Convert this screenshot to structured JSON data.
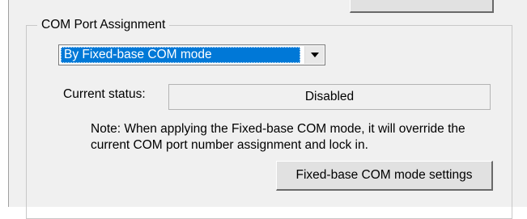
{
  "group": {
    "title": "COM Port Assignment"
  },
  "mode_select": {
    "selected": "By Fixed-base COM mode",
    "arrow_icon": "chevron-down-icon"
  },
  "status": {
    "label": "Current status:",
    "value": "Disabled"
  },
  "note": {
    "line1": "Note: When applying the Fixed-base COM mode, it will override the",
    "line2": "current COM port number assignment and lock in."
  },
  "settings_button": {
    "label": "Fixed-base COM mode settings"
  },
  "colors": {
    "panel_background": "#f0f0f0",
    "selection_highlight": "#0078d7",
    "button_face": "#e1e1e1"
  }
}
